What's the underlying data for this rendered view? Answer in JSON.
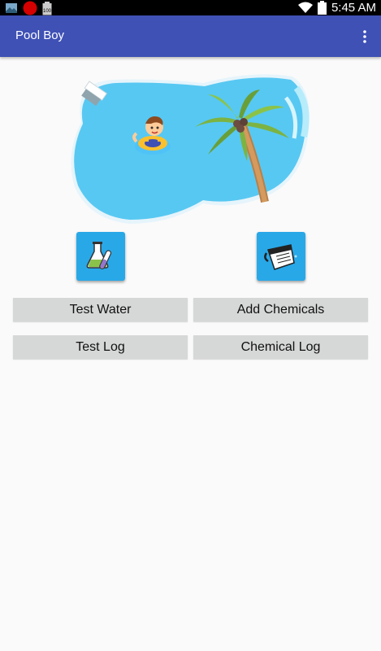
{
  "status_bar": {
    "time": "5:45 AM",
    "icons": [
      "photo-notification-icon",
      "record-indicator-icon",
      "battery-saver-icon",
      "wifi-icon",
      "battery-icon"
    ]
  },
  "app_bar": {
    "title": "Pool Boy",
    "menu_icon": "overflow-menu-icon"
  },
  "hero": {
    "image": "pool-illustration"
  },
  "actions": {
    "test_water_icon": "chemistry-test-icon",
    "add_chemicals_icon": "pour-chemical-icon",
    "test_water": "Test Water",
    "add_chemicals": "Add Chemicals",
    "test_log": "Test Log",
    "chemical_log": "Chemical Log"
  },
  "colors": {
    "app_bar": "#3f51b5",
    "icon_button": "#29a8e8",
    "button_bg": "#d6d7d7",
    "pool_water": "#57c8f2"
  }
}
